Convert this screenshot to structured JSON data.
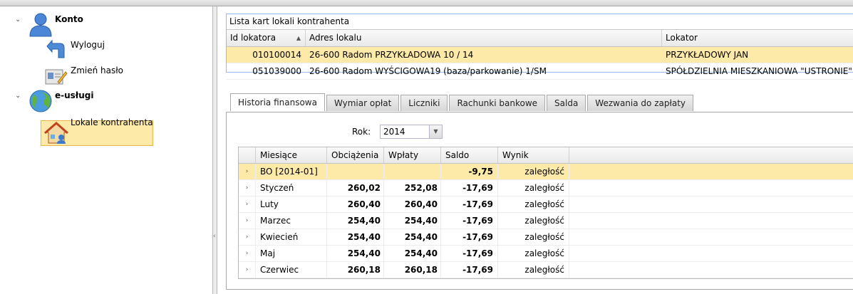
{
  "tree": {
    "konto": {
      "label": "Konto"
    },
    "wyloguj": {
      "label": "Wyloguj"
    },
    "zmien_haslo": {
      "label": "Zmień hasło"
    },
    "e_uslugi": {
      "label": "e-usługi"
    },
    "lokale": {
      "label": "Lokale kontrahenta"
    }
  },
  "lokale_grid": {
    "title": "Lista kart lokali kontrahenta",
    "columns": [
      "Id lokatora",
      "Adres lokalu",
      "Lokator"
    ],
    "rows": [
      {
        "id": "010100014",
        "adres": "26-600 Radom PRZYKŁADOWA 10 / 14",
        "lokator": "PRZYKŁADOWY JAN"
      },
      {
        "id": "051039000",
        "adres": "26-600 Radom WYŚCIGOWA19 (baza/parkowanie) 1/SM",
        "lokator": "SPÓŁDZIELNIA MIESZKANIOWA \"USTRONIE\""
      }
    ]
  },
  "tabs": [
    "Historia finansowa",
    "Wymiar opłat",
    "Liczniki",
    "Rachunki bankowe",
    "Salda",
    "Wezwania do zapłaty"
  ],
  "rok": {
    "label": "Rok:",
    "value": "2014"
  },
  "fin_grid": {
    "columns": [
      "Miesiące",
      "Obciążenia",
      "Wpłaty",
      "Saldo",
      "Wynik"
    ],
    "rows": [
      {
        "miesiac": "BO [2014-01]",
        "obc": "",
        "wpl": "",
        "saldo": "-9,75",
        "wynik": "zaległość"
      },
      {
        "miesiac": "Styczeń",
        "obc": "260,02",
        "wpl": "252,08",
        "saldo": "-17,69",
        "wynik": "zaległość"
      },
      {
        "miesiac": "Luty",
        "obc": "260,40",
        "wpl": "260,40",
        "saldo": "-17,69",
        "wynik": "zaległość"
      },
      {
        "miesiac": "Marzec",
        "obc": "254,40",
        "wpl": "254,40",
        "saldo": "-17,69",
        "wynik": "zaległość"
      },
      {
        "miesiac": "Kwiecień",
        "obc": "254,40",
        "wpl": "254,40",
        "saldo": "-17,69",
        "wynik": "zaległość"
      },
      {
        "miesiac": "Maj",
        "obc": "254,40",
        "wpl": "254,40",
        "saldo": "-17,69",
        "wynik": "zaległość"
      },
      {
        "miesiac": "Czerwiec",
        "obc": "260,18",
        "wpl": "260,18",
        "saldo": "-17,69",
        "wynik": "zaległość"
      }
    ]
  },
  "colors": {
    "selection": "#fde9a8",
    "selection_border": "#e8b645",
    "panel_border": "#99bbe8"
  }
}
